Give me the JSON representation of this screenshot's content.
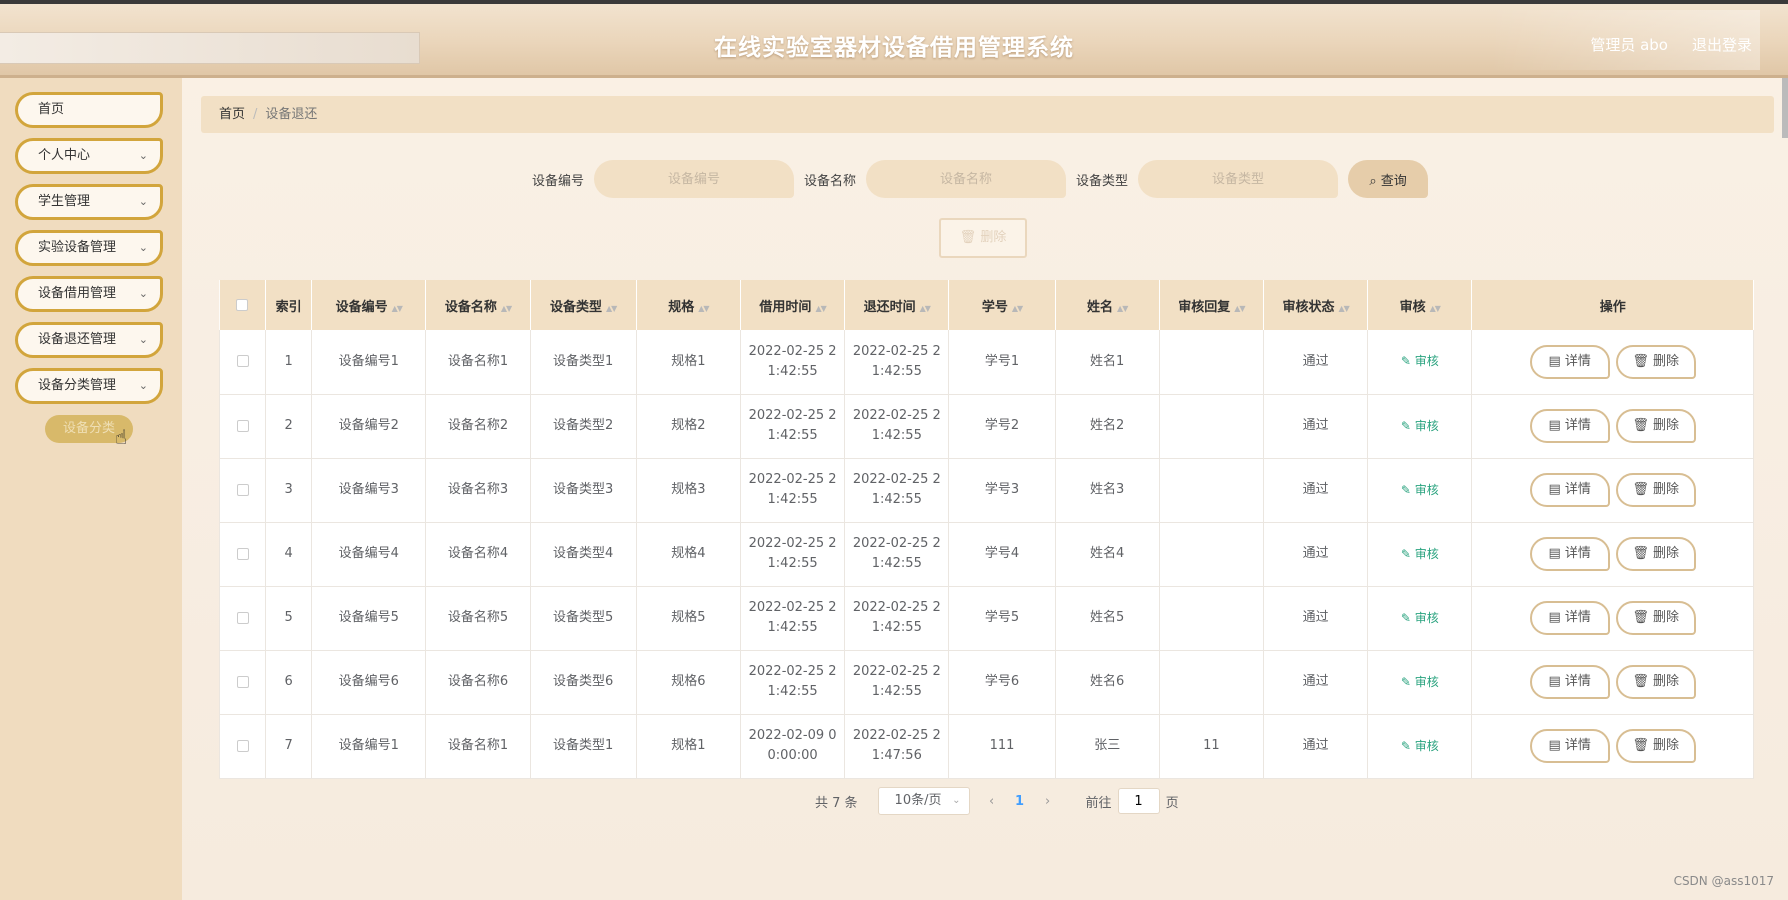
{
  "header": {
    "title": "在线实验室器材设备借用管理系统",
    "user": "管理员 abo",
    "logout": "退出登录"
  },
  "sidebar": {
    "items": [
      {
        "label": "首页",
        "has_arrow": false
      },
      {
        "label": "个人中心",
        "has_arrow": true
      },
      {
        "label": "学生管理",
        "has_arrow": true
      },
      {
        "label": "实验设备管理",
        "has_arrow": true
      },
      {
        "label": "设备借用管理",
        "has_arrow": true
      },
      {
        "label": "设备退还管理",
        "has_arrow": true
      },
      {
        "label": "设备分类管理",
        "has_arrow": true
      }
    ],
    "submenu": "设备分类"
  },
  "breadcrumb": {
    "home": "首页",
    "separator": "/",
    "current": "设备退还"
  },
  "search": {
    "fields": [
      {
        "label": "设备编号",
        "placeholder": "设备编号"
      },
      {
        "label": "设备名称",
        "placeholder": "设备名称"
      },
      {
        "label": "设备类型",
        "placeholder": "设备类型"
      }
    ],
    "query_label": "查询"
  },
  "toolbar": {
    "delete_label": "删除"
  },
  "table": {
    "columns": [
      "索引",
      "设备编号",
      "设备名称",
      "设备类型",
      "规格",
      "借用时间",
      "退还时间",
      "学号",
      "姓名",
      "审核回复",
      "审核状态",
      "审核",
      "操作"
    ],
    "rows": [
      {
        "index": "1",
        "code": "设备编号1",
        "name": "设备名称1",
        "type": "设备类型1",
        "spec": "规格1",
        "borrow_time": [
          "2022-02-25 2",
          "1:42:55"
        ],
        "return_time": [
          "2022-02-25 2",
          "1:42:55"
        ],
        "student_no": "学号1",
        "student_name": "姓名1",
        "reply": "",
        "status": "通过"
      },
      {
        "index": "2",
        "code": "设备编号2",
        "name": "设备名称2",
        "type": "设备类型2",
        "spec": "规格2",
        "borrow_time": [
          "2022-02-25 2",
          "1:42:55"
        ],
        "return_time": [
          "2022-02-25 2",
          "1:42:55"
        ],
        "student_no": "学号2",
        "student_name": "姓名2",
        "reply": "",
        "status": "通过"
      },
      {
        "index": "3",
        "code": "设备编号3",
        "name": "设备名称3",
        "type": "设备类型3",
        "spec": "规格3",
        "borrow_time": [
          "2022-02-25 2",
          "1:42:55"
        ],
        "return_time": [
          "2022-02-25 2",
          "1:42:55"
        ],
        "student_no": "学号3",
        "student_name": "姓名3",
        "reply": "",
        "status": "通过"
      },
      {
        "index": "4",
        "code": "设备编号4",
        "name": "设备名称4",
        "type": "设备类型4",
        "spec": "规格4",
        "borrow_time": [
          "2022-02-25 2",
          "1:42:55"
        ],
        "return_time": [
          "2022-02-25 2",
          "1:42:55"
        ],
        "student_no": "学号4",
        "student_name": "姓名4",
        "reply": "",
        "status": "通过"
      },
      {
        "index": "5",
        "code": "设备编号5",
        "name": "设备名称5",
        "type": "设备类型5",
        "spec": "规格5",
        "borrow_time": [
          "2022-02-25 2",
          "1:42:55"
        ],
        "return_time": [
          "2022-02-25 2",
          "1:42:55"
        ],
        "student_no": "学号5",
        "student_name": "姓名5",
        "reply": "",
        "status": "通过"
      },
      {
        "index": "6",
        "code": "设备编号6",
        "name": "设备名称6",
        "type": "设备类型6",
        "spec": "规格6",
        "borrow_time": [
          "2022-02-25 2",
          "1:42:55"
        ],
        "return_time": [
          "2022-02-25 2",
          "1:42:55"
        ],
        "student_no": "学号6",
        "student_name": "姓名6",
        "reply": "",
        "status": "通过"
      },
      {
        "index": "7",
        "code": "设备编号1",
        "name": "设备名称1",
        "type": "设备类型1",
        "spec": "规格1",
        "borrow_time": [
          "2022-02-09 0",
          "0:00:00"
        ],
        "return_time": [
          "2022-02-25 2",
          "1:47:56"
        ],
        "student_no": "111",
        "student_name": "张三",
        "reply": "11",
        "status": "通过"
      }
    ],
    "audit_label": "审核",
    "detail_label": "详情",
    "delete_label": "删除"
  },
  "pagination": {
    "total": "共 7 条",
    "page_size": "10条/页",
    "current_page": "1",
    "goto_prefix": "前往",
    "goto_value": "1",
    "goto_suffix": "页"
  },
  "watermark": "CSDN @ass1017",
  "colors": {
    "accent_border": "#d2a53c",
    "header_bg": "#f2e0c5",
    "audit_green": "#2aa37f",
    "pager_active": "#409eff"
  }
}
